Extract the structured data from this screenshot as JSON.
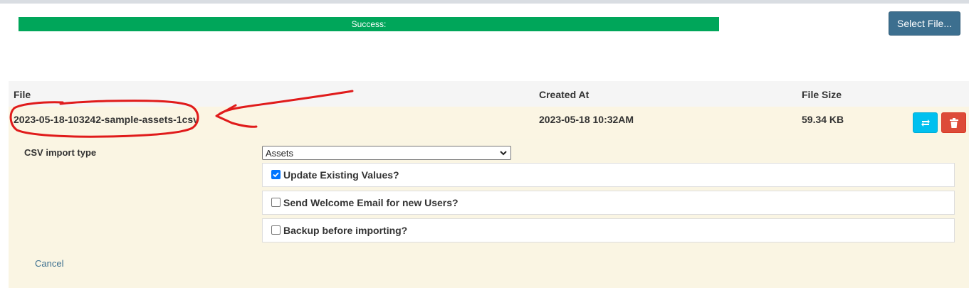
{
  "progress": {
    "label": "Success:",
    "percent": 100,
    "color": "#00a65a"
  },
  "upload": {
    "select_file_label": "Select File..."
  },
  "table": {
    "headers": {
      "file": "File",
      "created_at": "Created At",
      "file_size": "File Size"
    },
    "rows": [
      {
        "file": "2023-05-18-103242-sample-assets-1csv",
        "created_at": "2023-05-18 10:32AM",
        "file_size": "59.34 KB"
      }
    ]
  },
  "import_panel": {
    "csv_type_label": "CSV import type",
    "csv_type_selected": "Assets",
    "options": [
      {
        "label": "Update Existing Values?",
        "checked": true
      },
      {
        "label": "Send Welcome Email for new Users?",
        "checked": false
      },
      {
        "label": "Backup before importing?",
        "checked": false
      }
    ],
    "cancel_label": "Cancel"
  },
  "colors": {
    "row_highlight": "#fbf5e3",
    "refresh_button": "#00c0ef",
    "delete_button": "#dd4b39",
    "select_file_button": "#3c6f8f",
    "annotation_ink": "#e01b1b"
  },
  "icons": {
    "refresh": "refresh-icon",
    "delete": "trash-icon",
    "select_arrow": "chevron-down-icon"
  }
}
